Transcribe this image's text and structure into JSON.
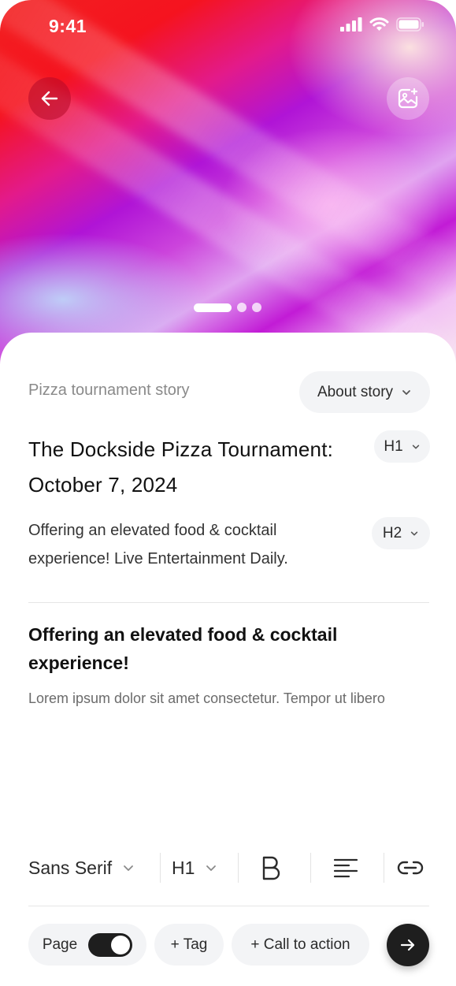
{
  "status_bar": {
    "time": "9:41"
  },
  "hero": {
    "carousel_pages": 3,
    "active_page": 1
  },
  "story_label": "Pizza tournament story",
  "about_dropdown": {
    "label": "About story"
  },
  "title": {
    "text": "The Dockside Pizza Tournament: October 7, 2024",
    "level": "H1"
  },
  "subtitle": {
    "text": "Offering an elevated food & cocktail experience!  Live Entertainment Daily.",
    "level": "H2"
  },
  "body": {
    "heading": "Offering an elevated food & cocktail experience!",
    "text": "Lorem ipsum dolor sit amet consectetur. Tempor ut libero"
  },
  "toolbar": {
    "font_family": "Sans Serif",
    "heading_level": "H1",
    "bold_icon": "bold-icon",
    "align_icon": "align-left-icon",
    "link_icon": "link-icon"
  },
  "bottom_bar": {
    "page_label": "Page",
    "page_toggle_on": true,
    "tag_label": "+ Tag",
    "cta_label": "+ Call to action"
  },
  "colors": {
    "toggle_on": "#1e1e1e",
    "pill_bg": "#f3f4f6",
    "next_button": "#1e1e1e"
  }
}
